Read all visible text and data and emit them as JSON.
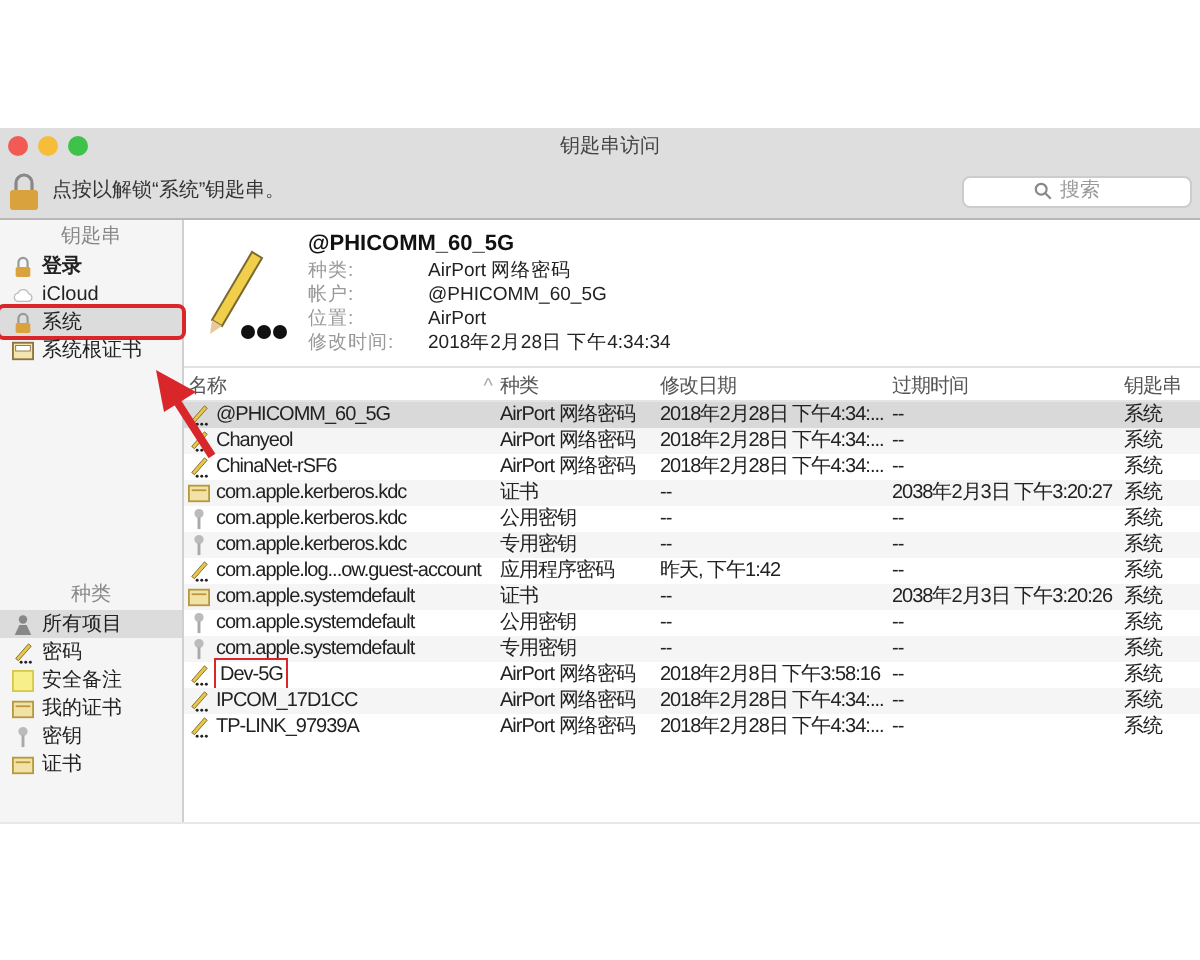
{
  "window": {
    "title": "钥匙串访问"
  },
  "toolbar": {
    "lock_message": "点按以解锁“系统”钥匙串。",
    "search": {
      "placeholder": "搜索"
    }
  },
  "sidebar": {
    "keychains_header": "钥匙串",
    "keychains": [
      {
        "label": "登录",
        "kind": "lock",
        "selected": false,
        "annotated": false,
        "bold": true
      },
      {
        "label": "iCloud",
        "kind": "cloud",
        "selected": false,
        "annotated": false,
        "bold": false
      },
      {
        "label": "系统",
        "kind": "lock",
        "selected": true,
        "annotated": true,
        "bold": false
      },
      {
        "label": "系统根证书",
        "kind": "cabinet",
        "selected": false,
        "annotated": false,
        "bold": false
      }
    ],
    "categories_header": "种类",
    "categories": [
      {
        "label": "所有项目",
        "kind": "people",
        "selected": true
      },
      {
        "label": "密码",
        "kind": "password",
        "selected": false
      },
      {
        "label": "安全备注",
        "kind": "note",
        "selected": false
      },
      {
        "label": "我的证书",
        "kind": "cert",
        "selected": false
      },
      {
        "label": "密钥",
        "kind": "key",
        "selected": false
      },
      {
        "label": "证书",
        "kind": "cert",
        "selected": false
      }
    ]
  },
  "detail": {
    "title": "@PHICOMM_60_5G",
    "fields": [
      {
        "label": "种类:",
        "value": "AirPort 网络密码"
      },
      {
        "label": "帐户:",
        "value": "@PHICOMM_60_5G"
      },
      {
        "label": "位置:",
        "value": "AirPort"
      },
      {
        "label": "修改时间:",
        "value": "2018年2月28日 下午4:34:34"
      }
    ]
  },
  "table": {
    "columns": [
      "名称",
      "种类",
      "修改日期",
      "过期时间",
      "钥匙串"
    ],
    "sort_mark": "^",
    "rows": [
      {
        "kind": "password",
        "name": "@PHICOMM_60_5G",
        "type": "AirPort 网络密码",
        "modified": "2018年2月28日 下午4:34:...",
        "expires": "--",
        "keychain": "系统",
        "selected": true,
        "annotated": false
      },
      {
        "kind": "password",
        "name": "Chanyeol",
        "type": "AirPort 网络密码",
        "modified": "2018年2月28日 下午4:34:...",
        "expires": "--",
        "keychain": "系统",
        "selected": false,
        "annotated": false
      },
      {
        "kind": "password",
        "name": "ChinaNet-rSF6",
        "type": "AirPort 网络密码",
        "modified": "2018年2月28日 下午4:34:...",
        "expires": "--",
        "keychain": "系统",
        "selected": false,
        "annotated": false
      },
      {
        "kind": "cert",
        "name": "com.apple.kerberos.kdc",
        "type": "证书",
        "modified": "--",
        "expires": "2038年2月3日 下午3:20:27",
        "keychain": "系统",
        "selected": false,
        "annotated": false
      },
      {
        "kind": "key",
        "name": "com.apple.kerberos.kdc",
        "type": "公用密钥",
        "modified": "--",
        "expires": "--",
        "keychain": "系统",
        "selected": false,
        "annotated": false
      },
      {
        "kind": "key",
        "name": "com.apple.kerberos.kdc",
        "type": "专用密钥",
        "modified": "--",
        "expires": "--",
        "keychain": "系统",
        "selected": false,
        "annotated": false
      },
      {
        "kind": "password",
        "name": "com.apple.log...ow.guest-account",
        "type": "应用程序密码",
        "modified": "昨天, 下午1:42",
        "expires": "--",
        "keychain": "系统",
        "selected": false,
        "annotated": false
      },
      {
        "kind": "cert",
        "name": "com.apple.systemdefault",
        "type": "证书",
        "modified": "--",
        "expires": "2038年2月3日 下午3:20:26",
        "keychain": "系统",
        "selected": false,
        "annotated": false
      },
      {
        "kind": "key",
        "name": "com.apple.systemdefault",
        "type": "公用密钥",
        "modified": "--",
        "expires": "--",
        "keychain": "系统",
        "selected": false,
        "annotated": false
      },
      {
        "kind": "key",
        "name": "com.apple.systemdefault",
        "type": "专用密钥",
        "modified": "--",
        "expires": "--",
        "keychain": "系统",
        "selected": false,
        "annotated": false
      },
      {
        "kind": "password",
        "name": "Dev-5G",
        "type": "AirPort 网络密码",
        "modified": "2018年2月8日 下午3:58:16",
        "expires": "--",
        "keychain": "系统",
        "selected": false,
        "annotated": true
      },
      {
        "kind": "password",
        "name": "IPCOM_17D1CC",
        "type": "AirPort 网络密码",
        "modified": "2018年2月28日 下午4:34:...",
        "expires": "--",
        "keychain": "系统",
        "selected": false,
        "annotated": false
      },
      {
        "kind": "password",
        "name": "TP-LINK_97939A",
        "type": "AirPort 网络密码",
        "modified": "2018年2月28日 下午4:34:...",
        "expires": "--",
        "keychain": "系统",
        "selected": false,
        "annotated": false
      }
    ]
  }
}
